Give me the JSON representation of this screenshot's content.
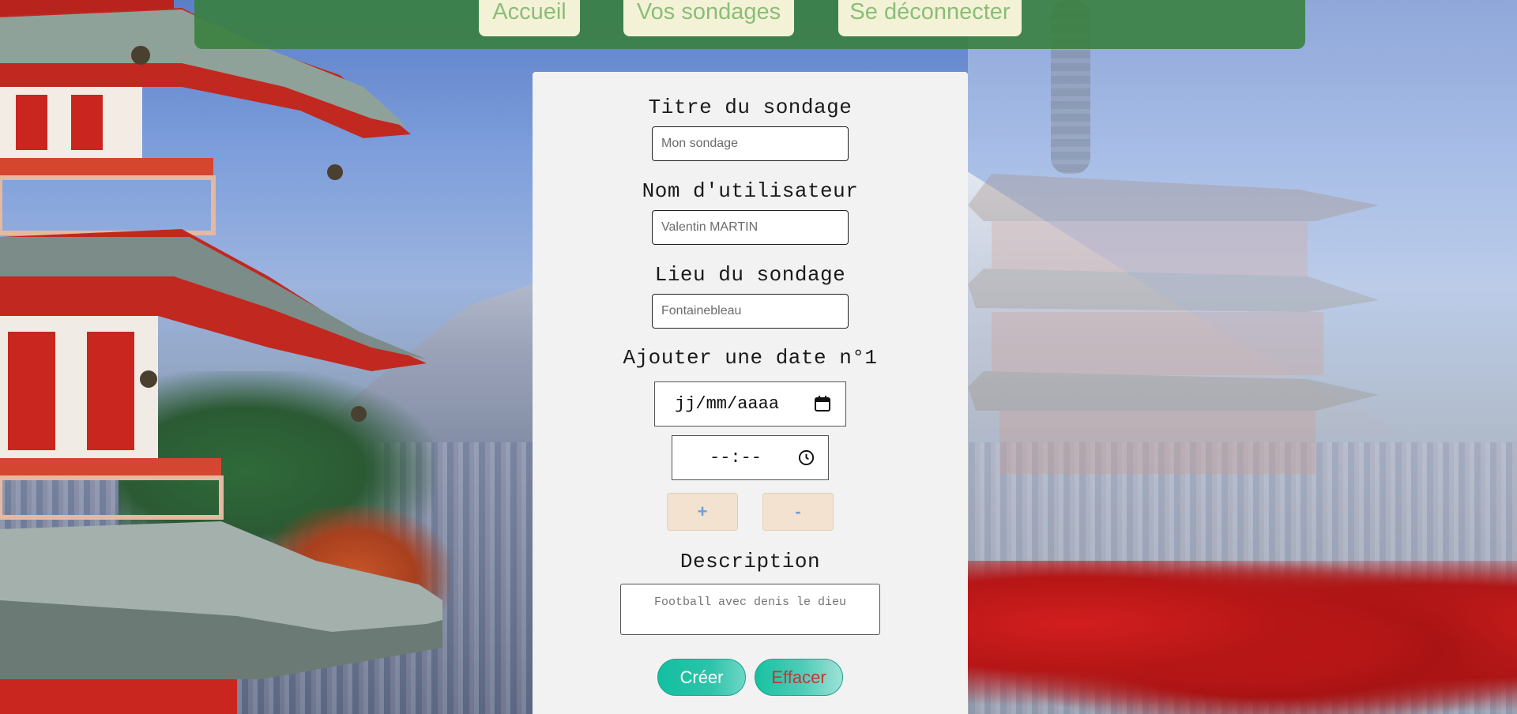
{
  "nav": {
    "home_label": "Accueil",
    "polls_label": "Vos sondages",
    "logout_label": "Se déconnecter"
  },
  "form": {
    "title_label": "Titre du sondage",
    "title_placeholder": "Mon sondage",
    "username_label": "Nom d'utilisateur",
    "username_placeholder": "Valentin MARTIN",
    "location_label": "Lieu du sondage",
    "location_placeholder": "Fontainebleau",
    "date_label": "Ajouter une date n°1",
    "date_placeholder": "jj/mm/aaaa",
    "time_placeholder": "--:--",
    "add_date_label": "+",
    "remove_date_label": "-",
    "description_label": "Description",
    "description_placeholder": "Football avec denis le dieu",
    "create_label": "Créer",
    "clear_label": "Effacer"
  },
  "icons": {
    "date": "calendar-icon",
    "time": "clock-icon"
  },
  "colors": {
    "navbar": "#38803c",
    "nav_button_bg": "#f4f2d6",
    "nav_button_text": "#8bbd78",
    "card_bg": "#f2f2f2",
    "primary_button": "#13bfa0",
    "clear_text": "#c0392b"
  }
}
